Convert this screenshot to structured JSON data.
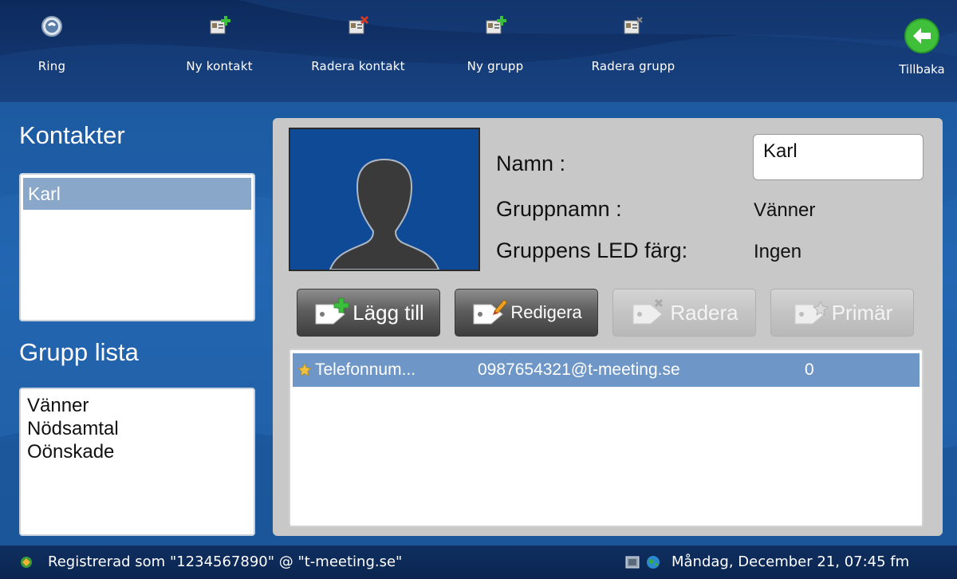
{
  "toolbar": {
    "ring": {
      "label": "Ring",
      "icon": "phone-globe-icon"
    },
    "new_contact": {
      "label": "Ny kontakt",
      "icon": "add-contact-icon"
    },
    "delete_contact": {
      "label": "Radera kontakt",
      "icon": "delete-contact-icon"
    },
    "new_group": {
      "label": "Ny grupp",
      "icon": "add-group-icon"
    },
    "delete_group": {
      "label": "Radera grupp",
      "icon": "delete-group-icon"
    },
    "back": {
      "label": "Tillbaka",
      "icon": "back-arrow-icon"
    }
  },
  "contacts": {
    "title": "Kontakter",
    "items": [
      {
        "label": "Karl",
        "selected": true
      }
    ]
  },
  "groups": {
    "title": "Grupp lista",
    "items": [
      {
        "label": "Vänner"
      },
      {
        "label": "Nödsamtal"
      },
      {
        "label": "Oönskade"
      }
    ]
  },
  "detail": {
    "avatar_icon": "person-silhouette-icon",
    "name_label": "Namn :",
    "name_value": "Karl",
    "group_label": "Gruppnamn :",
    "group_value": "Vänner",
    "led_label": "Gruppens LED färg:",
    "led_value": "Ingen"
  },
  "actions": {
    "add": {
      "label": "Lägg till",
      "enabled": true
    },
    "edit": {
      "label": "Redigera",
      "enabled": true
    },
    "delete": {
      "label": "Radera",
      "enabled": false
    },
    "primary": {
      "label": "Primär",
      "enabled": false
    }
  },
  "numbers": [
    {
      "type": "Telefonnum...",
      "address": "0987654321@t-meeting.se",
      "index": "0",
      "primary": true
    }
  ],
  "status": {
    "registration": "Registrerad som \"1234567890\" @ \"t-meeting.se\"",
    "datetime": "Måndag, December 21, 07:45 fm"
  },
  "colors": {
    "toolbar_bg": "#12356e",
    "main_bg": "#1f63ae",
    "selection": "#6e96c6",
    "back_button": "#3fbf3a"
  }
}
